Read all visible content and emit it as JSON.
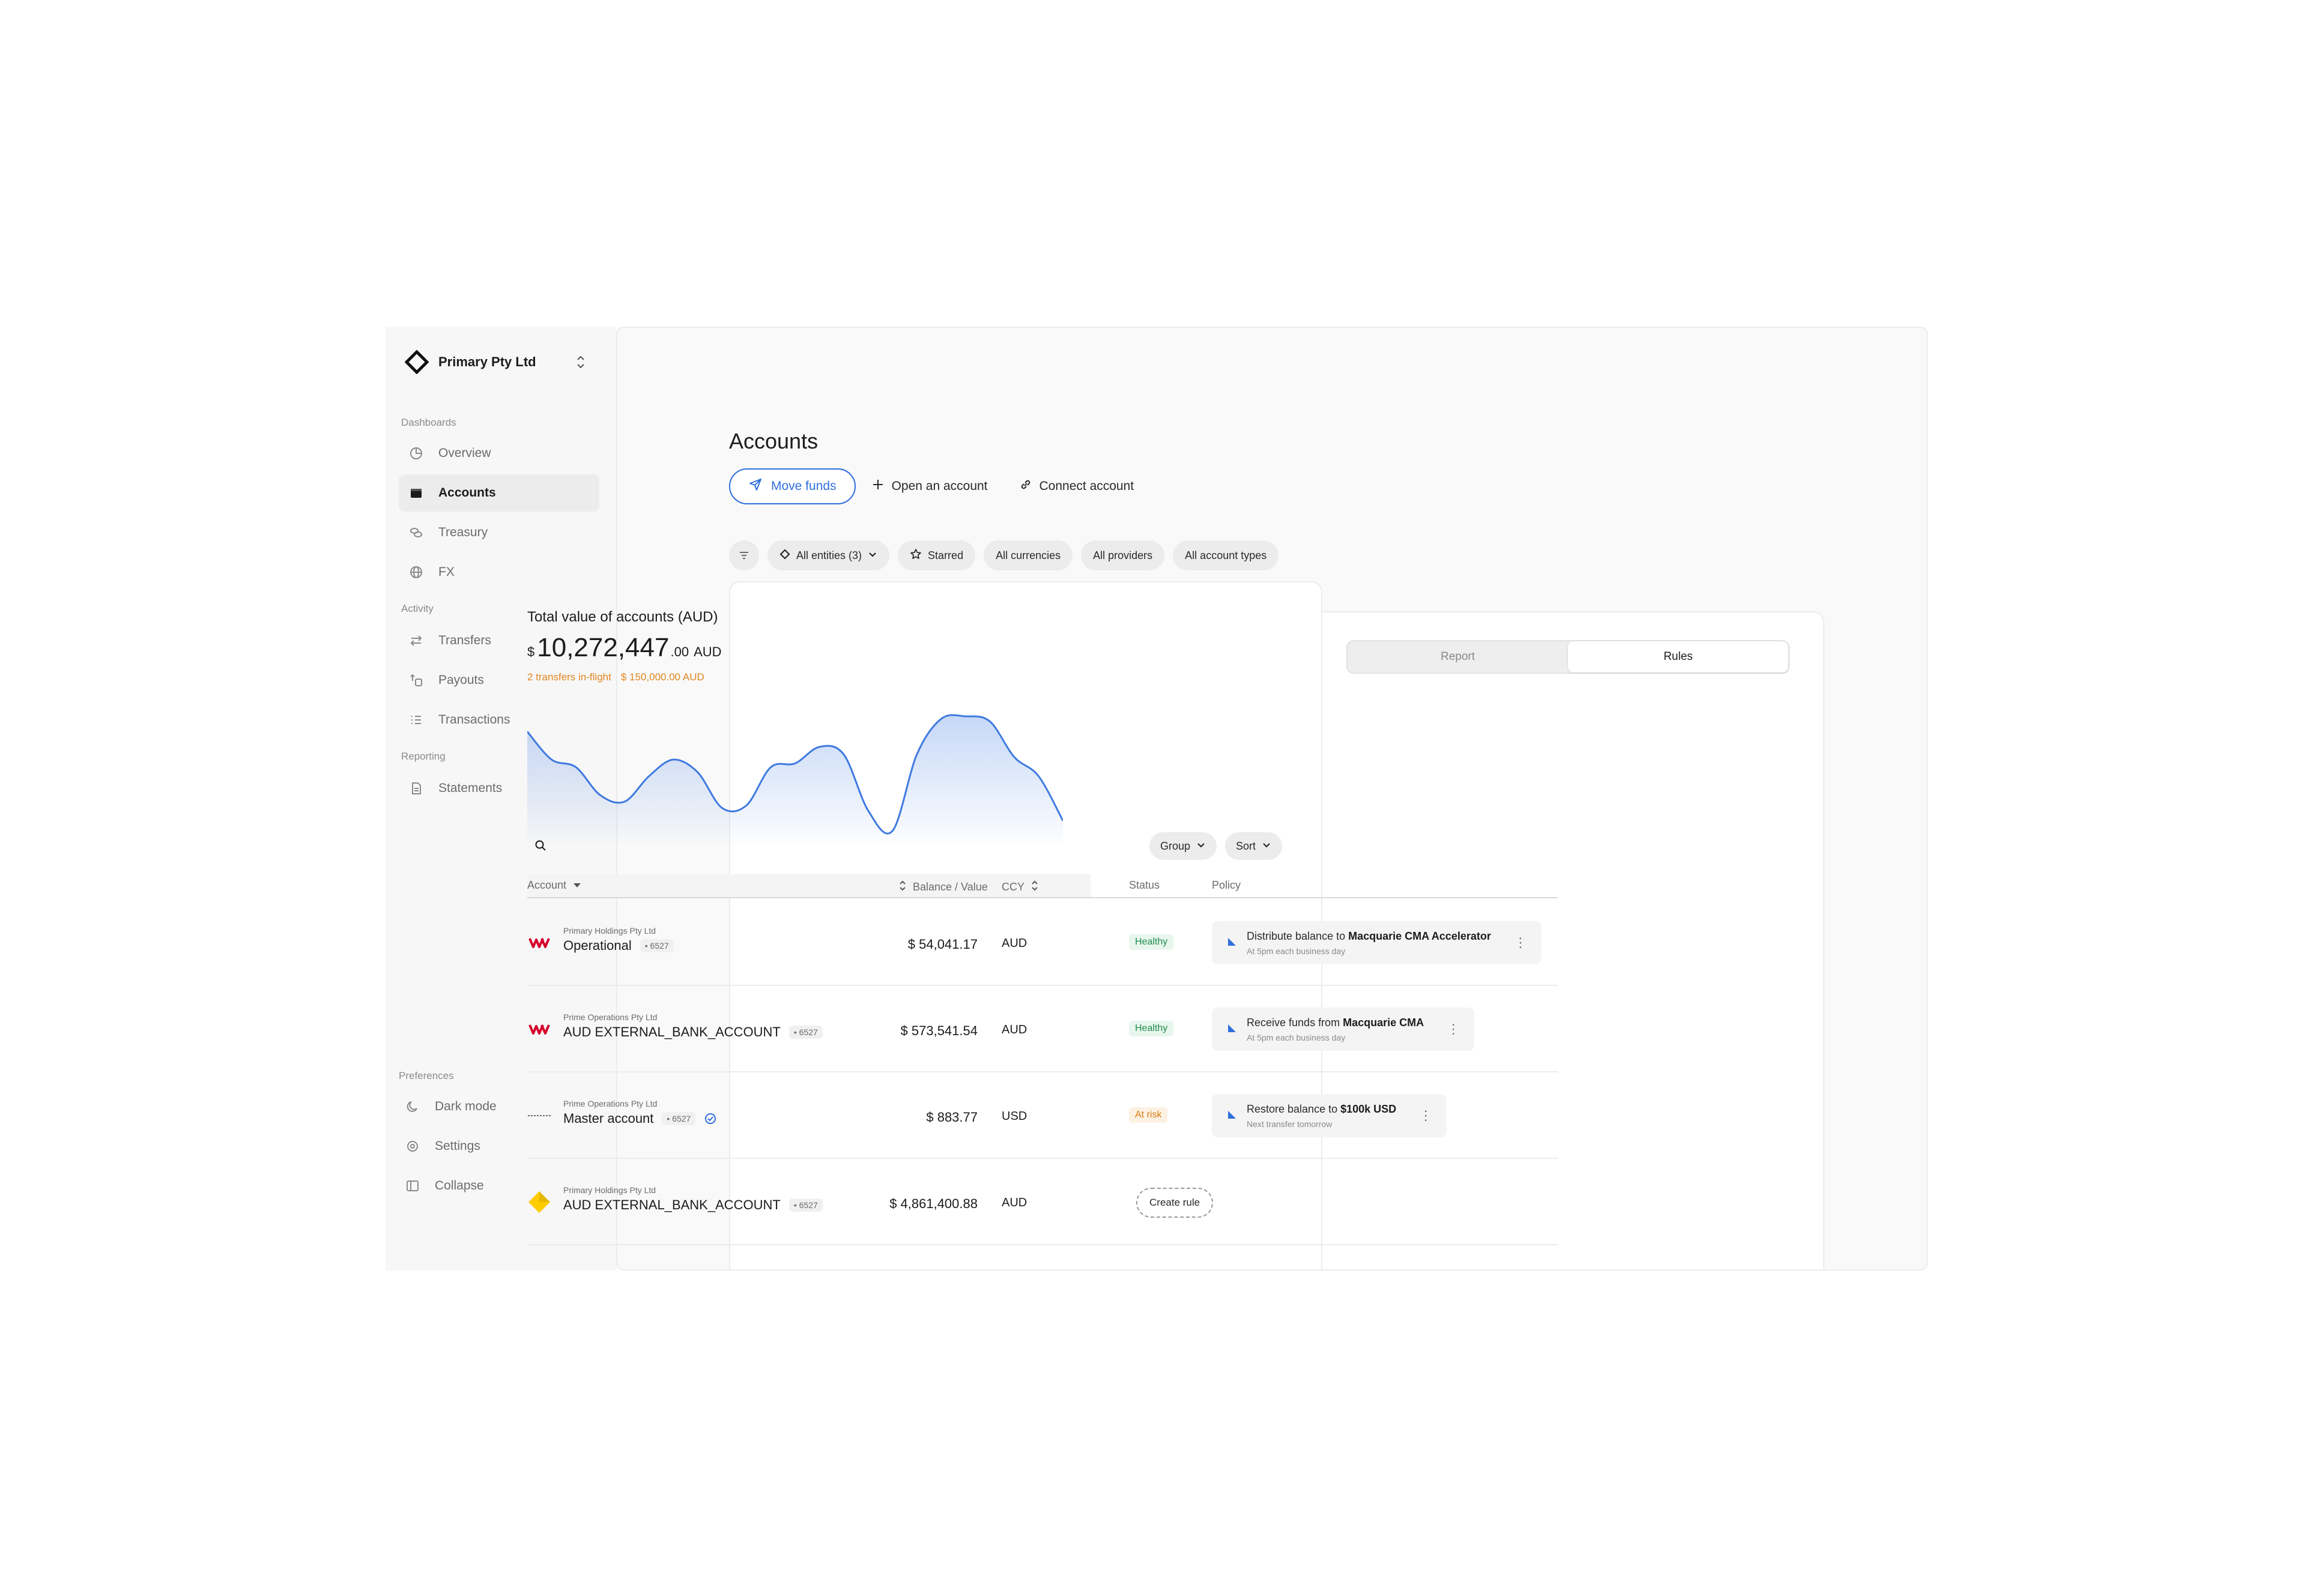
{
  "colors": {
    "accent": "#2f6fde",
    "warning": "#e0861f",
    "healthy": "#1f8b4c",
    "risk": "#d97a14"
  },
  "org": {
    "name": "Primary Pty Ltd",
    "logo_icon": "diamond-logo-icon",
    "switch_icon": "chevron-up-down-icon"
  },
  "sidebar": {
    "sections": [
      {
        "label": "Dashboards",
        "items": [
          {
            "label": "Overview",
            "icon": "pie-chart-icon",
            "active": false
          },
          {
            "label": "Accounts",
            "icon": "wallet-icon",
            "active": true
          },
          {
            "label": "Treasury",
            "icon": "coins-icon",
            "active": false
          },
          {
            "label": "FX",
            "icon": "globe-icon",
            "active": false
          }
        ]
      },
      {
        "label": "Activity",
        "items": [
          {
            "label": "Transfers",
            "icon": "arrows-left-right-icon",
            "active": false
          },
          {
            "label": "Payouts",
            "icon": "payout-icon",
            "active": false
          },
          {
            "label": "Transactions",
            "icon": "list-icon",
            "active": false
          }
        ]
      },
      {
        "label": "Reporting",
        "items": [
          {
            "label": "Statements",
            "icon": "document-icon",
            "active": false
          }
        ]
      }
    ],
    "preferences": {
      "label": "Preferences",
      "items": [
        {
          "label": "Dark mode",
          "icon": "moon-icon"
        },
        {
          "label": "Settings",
          "icon": "gear-icon"
        },
        {
          "label": "Collapse",
          "icon": "sidebar-icon"
        }
      ]
    }
  },
  "page": {
    "title": "Accounts",
    "actions": {
      "move_funds": "Move funds",
      "open_account": "Open an account",
      "connect_account": "Connect account"
    },
    "filters": {
      "entities": "All entities (3)",
      "starred": "Starred",
      "currencies": "All currencies",
      "providers": "All providers",
      "account_types": "All account types"
    }
  },
  "summary": {
    "title": "Total value of accounts (AUD)",
    "currency_symbol": "$",
    "value_main": "10,272,447",
    "value_decimal": ".00",
    "value_ccy": "AUD",
    "inflight_count": "2 transfers in-flight",
    "inflight_amount": "$ 150,000.00 AUD"
  },
  "chart_data": {
    "type": "area",
    "title": "",
    "xlabel": "",
    "ylabel": "",
    "values": [
      0.8,
      0.58,
      0.52,
      0.3,
      0.25,
      0.45,
      0.58,
      0.48,
      0.2,
      0.22,
      0.52,
      0.55,
      0.68,
      0.62,
      0.18,
      0.02,
      0.62,
      0.9,
      0.92,
      0.88,
      0.6,
      0.45,
      0.1
    ],
    "grid": false,
    "legend": "none"
  },
  "toolbar": {
    "group": "Group",
    "sort": "Sort"
  },
  "rules_panel": {
    "tabs": [
      {
        "label": "Report",
        "active": false
      },
      {
        "label": "Rules",
        "active": true
      }
    ]
  },
  "table": {
    "columns": {
      "account": "Account",
      "balance": "Balance / Value",
      "ccy": "CCY",
      "status": "Status",
      "policy": "Policy"
    },
    "rows": [
      {
        "bank": "westpac",
        "entity": "Primary Holdings Pty Ltd",
        "name": "Operational",
        "mask": "• 6527",
        "verified": false,
        "balance": "$ 54,041.17",
        "ccy": "AUD",
        "status": "Healthy",
        "status_type": "healthy",
        "policy": {
          "prefix": "Distribute balance to",
          "target": "Macquarie CMA Accelerator",
          "sub": "At 5pm each business day"
        }
      },
      {
        "bank": "westpac",
        "entity": "Prime Operations Pty Ltd",
        "name": "AUD EXTERNAL_BANK_ACCOUNT",
        "mask": "• 6527",
        "verified": false,
        "balance": "$ 573,541.54",
        "ccy": "AUD",
        "status": "Healthy",
        "status_type": "healthy",
        "policy": {
          "prefix": "Receive funds from",
          "target": "Macquarie CMA",
          "sub": "At 5pm each business day"
        }
      },
      {
        "bank": "jpmorgan",
        "entity": "Prime Operations Pty Ltd",
        "name": "Master account",
        "mask": "• 6527",
        "verified": true,
        "balance": "$ 883.77",
        "ccy": "USD",
        "status": "At risk",
        "status_type": "risk",
        "policy": {
          "prefix": "Restore balance to",
          "target": "$100k USD",
          "sub": "Next transfer tomorrow"
        }
      },
      {
        "bank": "commbank",
        "entity": "Primary Holdings Pty Ltd",
        "name": "AUD EXTERNAL_BANK_ACCOUNT",
        "mask": "• 6527",
        "verified": false,
        "balance": "$ 4,861,400.88",
        "ccy": "AUD",
        "status": "",
        "status_type": "none",
        "create_rule": "Create rule"
      }
    ]
  }
}
